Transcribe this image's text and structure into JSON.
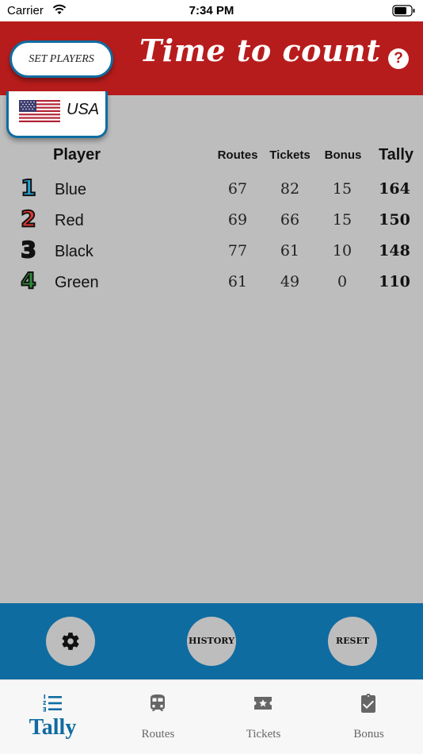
{
  "status": {
    "carrier": "Carrier",
    "time": "7:34 PM"
  },
  "header": {
    "set_players_label": "SET PLAYERS",
    "title": "Time to count",
    "help_label": "?"
  },
  "country": {
    "label": "USA"
  },
  "columns": {
    "player": "Player",
    "routes": "Routes",
    "tickets": "Tickets",
    "bonus": "Bonus",
    "tally": "Tally"
  },
  "players": [
    {
      "rank": "1",
      "name": "Blue",
      "color": "#29a3d6",
      "routes": "67",
      "tickets": "82",
      "bonus": "15",
      "tally": "164"
    },
    {
      "rank": "2",
      "name": "Red",
      "color": "#e53935",
      "routes": "69",
      "tickets": "66",
      "bonus": "15",
      "tally": "150"
    },
    {
      "rank": "3",
      "name": "Black",
      "color": "#111111",
      "routes": "77",
      "tickets": "61",
      "bonus": "10",
      "tally": "148"
    },
    {
      "rank": "4",
      "name": "Green",
      "color": "#2e8b3a",
      "routes": "61",
      "tickets": "49",
      "bonus": "0",
      "tally": "110"
    }
  ],
  "actions": {
    "settings_icon": "gear-icon",
    "history_label": "HISTORY",
    "reset_label": "RESET"
  },
  "tabs": [
    {
      "label": "Tally",
      "icon": "numbered-list-icon",
      "active": true
    },
    {
      "label": "Routes",
      "icon": "train-icon",
      "active": false
    },
    {
      "label": "Tickets",
      "icon": "ticket-star-icon",
      "active": false
    },
    {
      "label": "Bonus",
      "icon": "clipboard-check-icon",
      "active": false
    }
  ],
  "colors": {
    "header_red": "#b71c1c",
    "accent_blue": "#0f6ca0",
    "background_gray": "#bdbdbd"
  }
}
